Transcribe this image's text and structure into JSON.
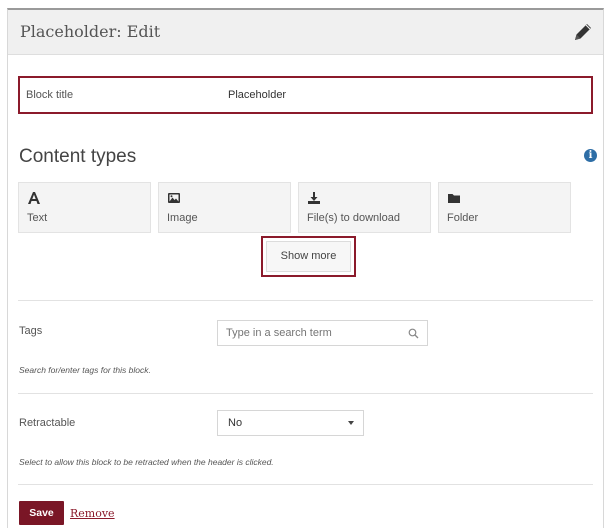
{
  "header": {
    "title": "Placeholder: Edit",
    "edit_icon": "pencil-icon"
  },
  "block_title": {
    "label": "Block title",
    "value": "Placeholder"
  },
  "content_types": {
    "heading": "Content types",
    "info_icon": "info-icon",
    "items": [
      {
        "label": "Text",
        "icon": "text-icon"
      },
      {
        "label": "Image",
        "icon": "image-icon"
      },
      {
        "label": "File(s) to download",
        "icon": "download-icon"
      },
      {
        "label": "Folder",
        "icon": "folder-icon"
      }
    ],
    "show_more_label": "Show more"
  },
  "tags": {
    "label": "Tags",
    "placeholder": "Type in a search term",
    "help": "Search for/enter tags for this block.",
    "icon": "search-icon"
  },
  "retractable": {
    "label": "Retractable",
    "selected": "No",
    "help": "Select to allow this block to be retracted when the header is clicked."
  },
  "actions": {
    "save_label": "Save",
    "remove_label": "Remove"
  },
  "colors": {
    "accent": "#7a1626",
    "highlight_border": "#8b1a2b",
    "info": "#2e6ea6"
  }
}
